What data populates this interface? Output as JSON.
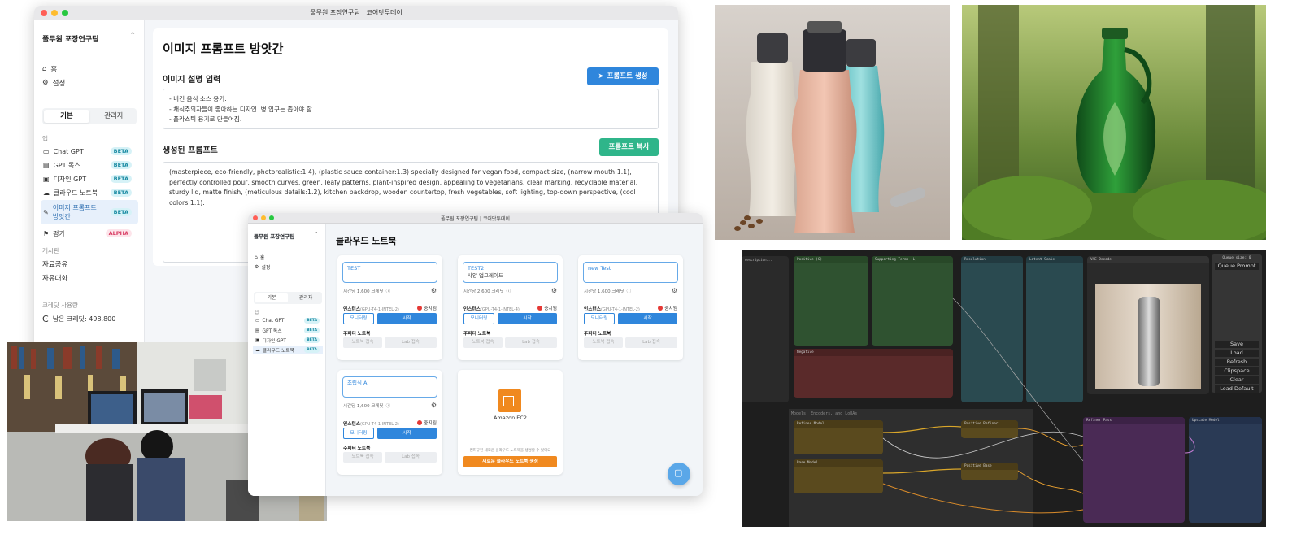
{
  "window1": {
    "title": "풀무원 포장연구팀 | 코어닷투데이",
    "team": "풀무원 포장연구팀",
    "nav": [
      {
        "label": "홈",
        "icon": "home-icon"
      },
      {
        "label": "설정",
        "icon": "gear-icon"
      }
    ],
    "tabs": [
      "기본",
      "관리자"
    ],
    "section_app": "앱",
    "apps": [
      {
        "label": "Chat GPT",
        "badge": "BETA"
      },
      {
        "label": "GPT 독스",
        "badge": "BETA"
      },
      {
        "label": "디자인 GPT",
        "badge": "BETA"
      },
      {
        "label": "클라우드 노트북",
        "badge": "BETA"
      },
      {
        "label": "이미지 프롬프트 방앗간",
        "badge": "BETA"
      },
      {
        "label": "평가",
        "badge": "ALPHA"
      }
    ],
    "section_board": "게시판",
    "board": [
      "자료공유",
      "자유대화"
    ],
    "section_credit": "크레딧 사용량",
    "credit": "남은 크레딧: 498,800",
    "page_title": "이미지 프롬프트 방앗간",
    "desc_label": "이미지 설명 입력",
    "generate_button": "프롬프트 생성",
    "desc_lines": [
      "- 비건 음식 소스 용기.",
      "- 채식주의자들이 좋아하는 디자인. 병 입구는 좁아야 함.",
      "- 플라스틱 용기로 만들어짐."
    ],
    "generated_label": "생성된 프롬프트",
    "copy_button": "프롬프트 복사",
    "generated_text": "(masterpiece, eco-friendly, photorealistic:1.4), (plastic sauce container:1.3) specially designed for vegan food, compact size, (narrow mouth:1.1), perfectly controlled pour, smooth curves, green, leafy patterns, plant-inspired design, appealing to vegetarians, clear marking, recyclable material, sturdy lid, matte finish, (meticulous details:1.2), kitchen backdrop, wooden countertop, fresh vegetables, soft lighting, top-down perspective, (cool colors:1.1)."
  },
  "window2": {
    "title": "풀무원 포장연구팀 | 코어닷투데이",
    "team": "풀무원 포장연구팀",
    "nav": [
      "홈",
      "설정"
    ],
    "tabs": [
      "기본",
      "관리자"
    ],
    "section_app": "앱",
    "apps": [
      {
        "label": "Chat GPT",
        "badge": "BETA"
      },
      {
        "label": "GPT 독스",
        "badge": "BETA"
      },
      {
        "label": "디자인 GPT",
        "badge": "BETA"
      },
      {
        "label": "클라우드 노트북",
        "badge": "BETA"
      }
    ],
    "page_title": "클라우드 노트북",
    "cards": [
      {
        "name": "TEST",
        "sub": "",
        "cost": "시간당 1,600 크레딧"
      },
      {
        "name": "TEST2",
        "sub": "사양 업그레이드",
        "cost": "시간당 2,600 크레딧"
      },
      {
        "name": "new Test",
        "sub": "",
        "cost": "시간당 1,600 크레딧"
      },
      {
        "name": "조립식 AI",
        "sub": "",
        "cost": "시간당 1,600 크레딧"
      }
    ],
    "card_instance_label": "인스턴스",
    "card_instance_types": [
      "(GPU-T4-1-INTEL-2)",
      "(GPU-T4-1-INTEL-4)",
      "(GPU-T4-1-INTEL-2)",
      "(GPU-T4-1-INTEL-2)"
    ],
    "card_status": "중지됨",
    "monitor_button": "모니터링",
    "start_button": "시작",
    "jupyter_label": "주피터 노트북",
    "notebook_button": "노트북 접속",
    "lab_button": "Lab 접속",
    "aws_logo_text": "Amazon EC2",
    "aws_hint": "컨피규된 새로운 클라우드 노트북을 생성할 수 있어요",
    "aws_button": "새로운 클라우드 노트북 생성"
  },
  "comfy": {
    "queue_size": "Queue size: 0",
    "queue_prompt": "Queue Prompt",
    "buttons": [
      "Save",
      "Load",
      "Refresh",
      "Clipspace",
      "Clear",
      "Load Default"
    ],
    "group_label": "Models, Encoders, and LoRAs"
  },
  "colors": {
    "blue": "#2f86dc",
    "green": "#2fb58a",
    "orange": "#f0891f",
    "beta_bg": "#d6f2f7",
    "alpha_text": "#d94066"
  }
}
